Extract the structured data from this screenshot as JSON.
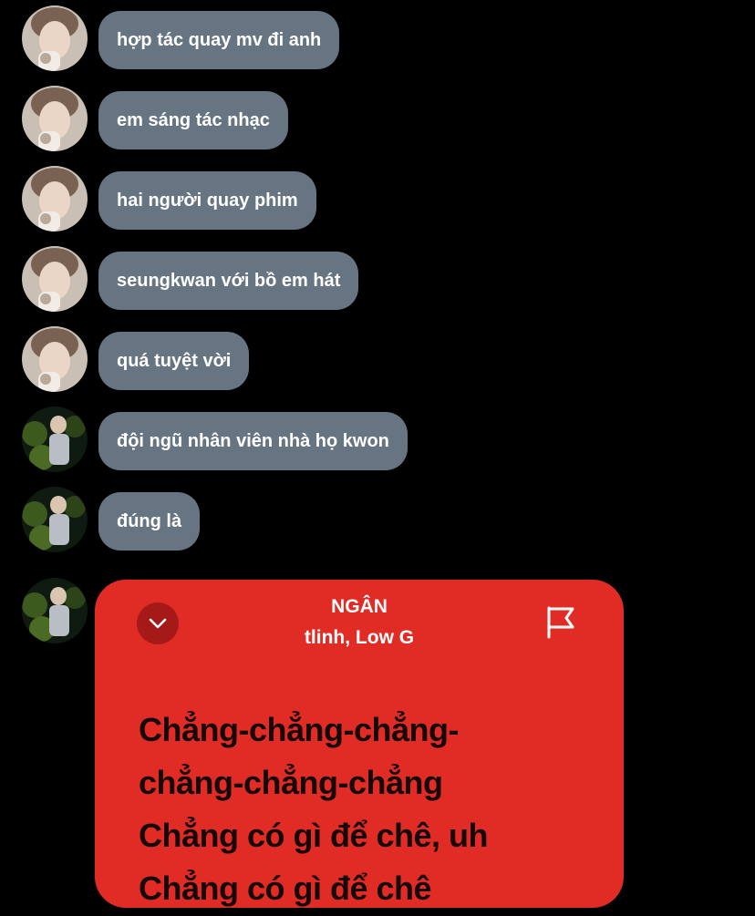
{
  "messages": [
    {
      "text": "hợp tác quay mv đi anh",
      "avatar": "avatar-boy-photo"
    },
    {
      "text": "em sáng tác nhạc",
      "avatar": "avatar-boy-photo"
    },
    {
      "text": "hai người quay phim",
      "avatar": "avatar-boy-photo"
    },
    {
      "text": "seungkwan với bồ em hát",
      "avatar": "avatar-boy-photo"
    },
    {
      "text": "quá tuyệt vời",
      "avatar": "avatar-boy-photo"
    },
    {
      "text": "đội ngũ nhân viên nhà họ kwon",
      "avatar": "avatar-forest-photo"
    },
    {
      "text": "đúng là",
      "avatar": "avatar-forest-photo"
    }
  ],
  "lyrics_card": {
    "song_title": "NGÂN",
    "artist": "tlinh, Low G",
    "lines": [
      "Chẳng-chẳng-chẳng-",
      "chẳng-chẳng-chẳng",
      "Chẳng có gì để chê, uh",
      "Chẳng có gì để chê"
    ],
    "collapse_icon": "chevron-down-icon",
    "report_icon": "flag-icon",
    "accent_color": "#e12c26"
  },
  "colors": {
    "background": "#000000",
    "bubble": "#677482",
    "bubble_text": "#ffffff"
  }
}
